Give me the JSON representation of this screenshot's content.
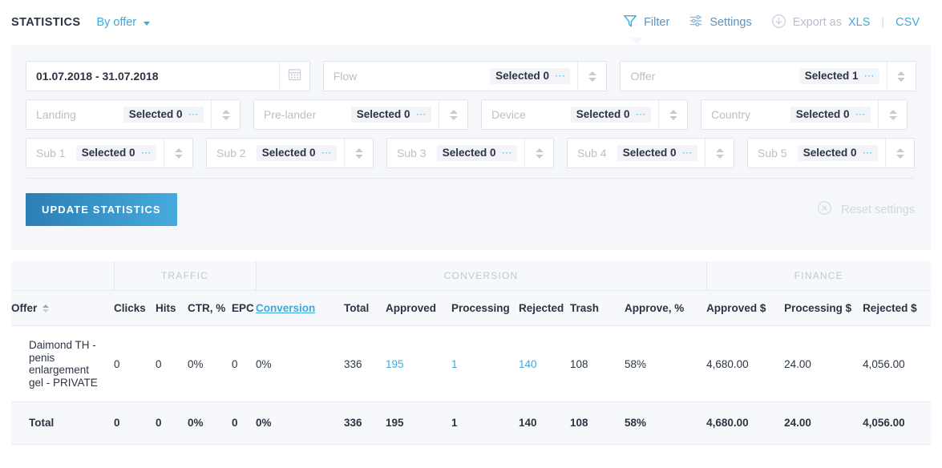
{
  "header": {
    "title": "STATISTICS",
    "mode_label": "By offer",
    "mode_caret": "chevron-down-icon",
    "actions": {
      "filter": "Filter",
      "settings": "Settings",
      "export_as": "Export as",
      "xls": "XLS",
      "separator": "|",
      "csv": "CSV"
    }
  },
  "filters": {
    "date_range": "01.07.2018 - 31.07.2018",
    "row1": [
      {
        "placeholder": "Flow",
        "selected": "Selected 0",
        "dots": "⋯"
      },
      {
        "placeholder": "Offer",
        "selected": "Selected 1",
        "dots": "⋯"
      }
    ],
    "row2": [
      {
        "placeholder": "Landing",
        "selected": "Selected 0",
        "dots": "⋯"
      },
      {
        "placeholder": "Pre-lander",
        "selected": "Selected 0",
        "dots": "⋯"
      },
      {
        "placeholder": "Device",
        "selected": "Selected 0",
        "dots": "⋯"
      },
      {
        "placeholder": "Country",
        "selected": "Selected 0",
        "dots": "⋯"
      }
    ],
    "row3": [
      {
        "placeholder": "Sub 1",
        "selected": "Selected 0",
        "dots": "⋯"
      },
      {
        "placeholder": "Sub 2",
        "selected": "Selected 0",
        "dots": "⋯"
      },
      {
        "placeholder": "Sub 3",
        "selected": "Selected 0",
        "dots": "⋯"
      },
      {
        "placeholder": "Sub 4",
        "selected": "Selected 0",
        "dots": "⋯"
      },
      {
        "placeholder": "Sub 5",
        "selected": "Selected 0",
        "dots": "⋯"
      }
    ],
    "update_button": "UPDATE STATISTICS",
    "reset_label": "Reset settings"
  },
  "table": {
    "groups": [
      {
        "label": "",
        "span": 1
      },
      {
        "label": "TRAFFIC",
        "span": 4
      },
      {
        "label": "CONVERSION",
        "span": 7
      },
      {
        "label": "FINANCE",
        "span": 3
      }
    ],
    "columns": [
      "Offer",
      "Clicks",
      "Hits",
      "CTR, %",
      "EPC",
      "Conversion",
      "Total",
      "Approved",
      "Processing",
      "Rejected",
      "Trash",
      "Approve, %",
      "Approved $",
      "Processing $",
      "Rejected $"
    ],
    "rows": [
      {
        "offer": "Daimond TH - penis enlargement gel - PRIVATE",
        "clicks": "0",
        "hits": "0",
        "ctr": "0%",
        "epc": "0",
        "conversion": "0%",
        "total": "336",
        "approved": "195",
        "processing": "1",
        "rejected": "140",
        "trash": "108",
        "approve_pct": "58%",
        "approved_usd": "4,680.00",
        "processing_usd": "24.00",
        "rejected_usd": "4,056.00"
      }
    ],
    "total_row": {
      "offer": "Total",
      "clicks": "0",
      "hits": "0",
      "ctr": "0%",
      "epc": "0",
      "conversion": "0%",
      "total": "336",
      "approved": "195",
      "processing": "1",
      "rejected": "140",
      "trash": "108",
      "approve_pct": "58%",
      "approved_usd": "4,680.00",
      "processing_usd": "24.00",
      "rejected_usd": "4,056.00"
    }
  },
  "colors": {
    "accent": "#3fa9dc",
    "button_gradient_start": "#2b7fb4",
    "button_gradient_end": "#46aadd",
    "panel_bg": "#f5f7fa",
    "text": "#2c3444",
    "muted": "#b9c0cc"
  }
}
